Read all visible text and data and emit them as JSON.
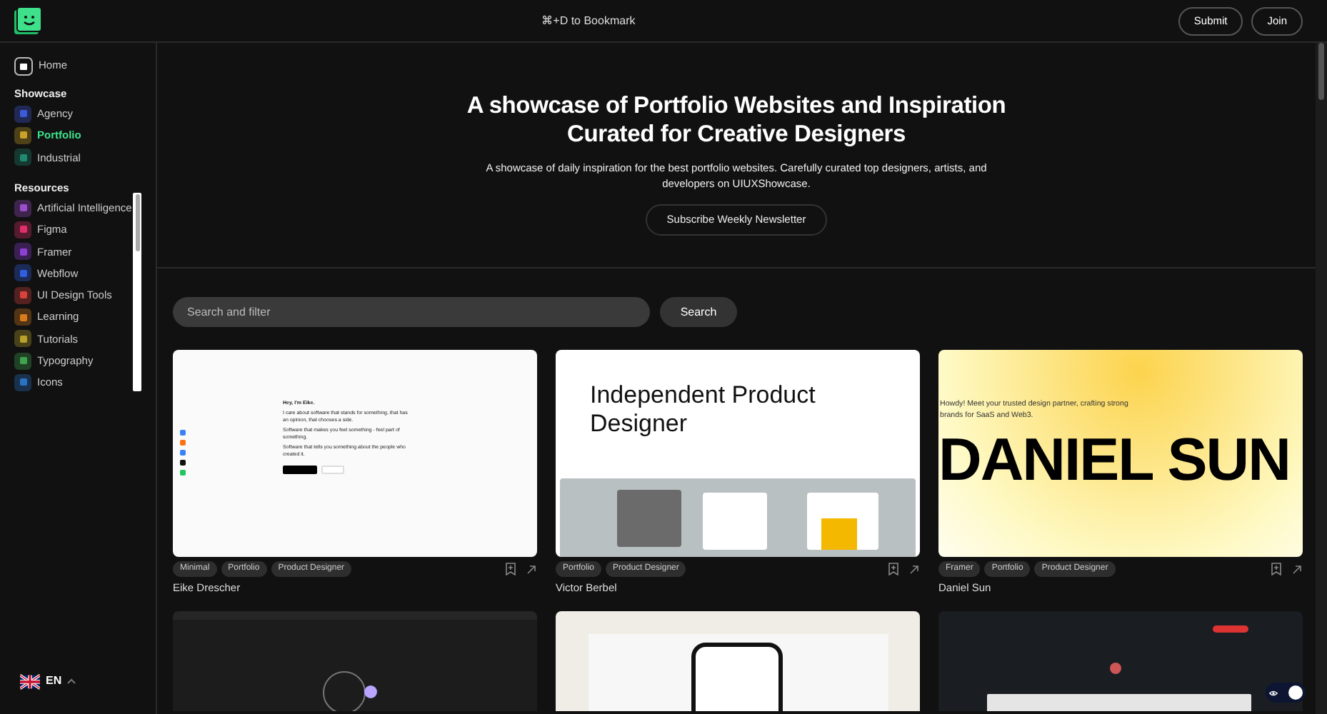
{
  "header": {
    "shortcut": "⌘+D to Bookmark",
    "buttons": [
      "Submit",
      "Join"
    ]
  },
  "sidebar": {
    "home": "Home",
    "sections": [
      {
        "title": "Showcase",
        "items": [
          {
            "label": "Agency",
            "selected": false,
            "color": "#3b5bdb"
          },
          {
            "label": "Portfolio",
            "selected": true,
            "color": "#c9a227"
          },
          {
            "label": "Industrial",
            "selected": false,
            "color": "#1f8a70"
          }
        ]
      },
      {
        "title": "Resources",
        "items": [
          {
            "label": "Artificial Intelligence",
            "selected": false,
            "color": "#9b4dca"
          },
          {
            "label": "Figma",
            "selected": false,
            "color": "#e0306b"
          },
          {
            "label": "Framer",
            "selected": false,
            "color": "#8e3fd6"
          },
          {
            "label": "Webflow",
            "selected": false,
            "color": "#2f5ee0"
          },
          {
            "label": "UI Design Tools",
            "selected": false,
            "color": "#d9423c"
          },
          {
            "label": "Learning",
            "selected": false,
            "color": "#d97a1c"
          },
          {
            "label": "Tutorials",
            "selected": false,
            "color": "#b8a12a"
          },
          {
            "label": "Typography",
            "selected": false,
            "color": "#3fa34d"
          },
          {
            "label": "Icons",
            "selected": false,
            "color": "#2a73c4"
          }
        ]
      }
    ],
    "language": "EN"
  },
  "hero": {
    "title": "A showcase of Portfolio Websites and Inspiration Curated for Creative Designers",
    "subtitle": "A showcase of daily inspiration for the best portfolio websites. Carefully curated top designers, artists, and developers on UIUXShowcase.",
    "button": "Subscribe Weekly Newsletter"
  },
  "search": {
    "placeholder": "Search and filter",
    "button": "Search"
  },
  "cards": [
    {
      "kind": "eike",
      "name": "Eike Drescher",
      "tags": [
        "Minimal",
        "Portfolio",
        "Product Designer"
      ],
      "preview": [
        "Hey, I'm Eike.",
        "I care about software that stands for something, that has an opinion, that chooses a side.",
        "Software that makes you feel something - feel part of something.",
        "Software that tells you something about the people who created it."
      ]
    },
    {
      "kind": "victor",
      "name": "Victor Berbel",
      "tags": [
        "Portfolio",
        "Product Designer"
      ],
      "preview": [
        "Independent Product Designer"
      ]
    },
    {
      "kind": "daniel",
      "name": "Daniel Sun",
      "tags": [
        "Framer",
        "Portfolio",
        "Product Designer"
      ],
      "preview": [
        "Howdy! Meet your trusted design partner, crafting strong brands for SaaS and Web3.",
        "DANIEL SUN"
      ]
    },
    {
      "kind": "dark"
    },
    {
      "kind": "phone"
    },
    {
      "kind": "sp"
    }
  ],
  "theme_toggle": {
    "on": true
  }
}
